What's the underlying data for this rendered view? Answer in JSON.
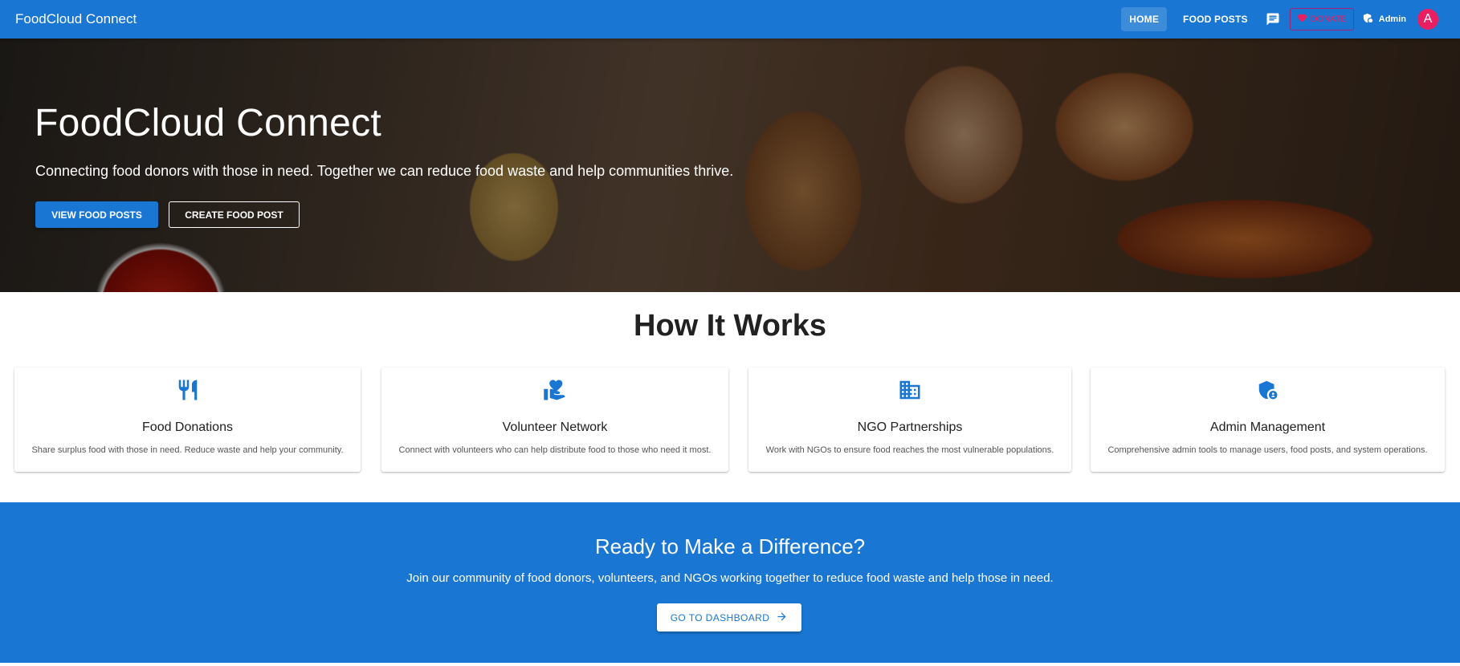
{
  "app": {
    "brand": "FoodCloud Connect"
  },
  "nav": {
    "home": "HOME",
    "food_posts": "FOOD POSTS",
    "donate": "DONATE",
    "admin": "Admin",
    "avatar_initial": "A"
  },
  "hero": {
    "title": "FoodCloud Connect",
    "subtitle": "Connecting food donors with those in need. Together we can reduce food waste and help communities thrive.",
    "primary_button": "VIEW FOOD POSTS",
    "secondary_button": "CREATE FOOD POST"
  },
  "how": {
    "title": "How It Works",
    "cards": [
      {
        "icon": "restaurant-icon",
        "title": "Food Donations",
        "desc": "Share surplus food with those in need. Reduce waste and help your community."
      },
      {
        "icon": "volunteer-hand-heart-icon",
        "title": "Volunteer Network",
        "desc": "Connect with volunteers who can help distribute food to those who need it most."
      },
      {
        "icon": "business-building-icon",
        "title": "NGO Partnerships",
        "desc": "Work with NGOs to ensure food reaches the most vulnerable populations."
      },
      {
        "icon": "admin-shield-icon",
        "title": "Admin Management",
        "desc": "Comprehensive admin tools to manage users, food posts, and system operations."
      }
    ]
  },
  "cta": {
    "title": "Ready to Make a Difference?",
    "subtitle": "Join our community of food donors, volunteers, and NGOs working together to reduce food waste and help those in need.",
    "button": "GO TO DASHBOARD"
  },
  "colors": {
    "primary": "#1976d2",
    "accent": "#e91e63"
  }
}
